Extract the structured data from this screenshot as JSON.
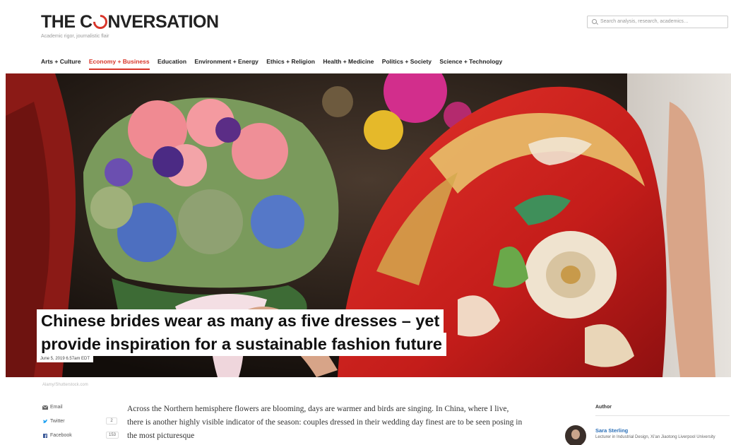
{
  "site": {
    "logo_pre": "THE C",
    "logo_post": "NVERSATION",
    "tagline": "Academic rigor, journalistic flair",
    "search_placeholder": "Search analysis, research, academics…"
  },
  "nav": {
    "items": [
      {
        "label": "Arts + Culture",
        "active": false
      },
      {
        "label": "Economy + Business",
        "active": true
      },
      {
        "label": "Education",
        "active": false
      },
      {
        "label": "Environment + Energy",
        "active": false
      },
      {
        "label": "Ethics + Religion",
        "active": false
      },
      {
        "label": "Health + Medicine",
        "active": false
      },
      {
        "label": "Politics + Society",
        "active": false
      },
      {
        "label": "Science + Technology",
        "active": false
      }
    ]
  },
  "hero": {
    "headline_line1": "Chinese brides wear as many as five dresses – yet",
    "headline_line2": "provide inspiration for a sustainable fashion future",
    "date": "June 5, 2019 6.57am EDT",
    "credit": "Alamy/Shutterstock.com"
  },
  "share": {
    "items": [
      {
        "label": "Email",
        "count": "",
        "icon": "email-icon"
      },
      {
        "label": "Twitter",
        "count": "2",
        "icon": "twitter-icon"
      },
      {
        "label": "Facebook",
        "count": "153",
        "icon": "facebook-icon"
      }
    ]
  },
  "article": {
    "text": "Across the Northern hemisphere flowers are blooming, days are warmer and birds are singing. In China, where I live, there is another highly visible indicator of the season: couples dressed in their wedding day finest are to be seen posing in the most picturesque"
  },
  "author": {
    "heading": "Author",
    "name": "Sara Sterling",
    "role": "Lecturer in Industrial Design, Xi'an Jiaotong Liverpool University"
  },
  "colors": {
    "brand_red": "#d8352a",
    "link_blue": "#2a6fb8",
    "dress_red": "#c8201c"
  }
}
